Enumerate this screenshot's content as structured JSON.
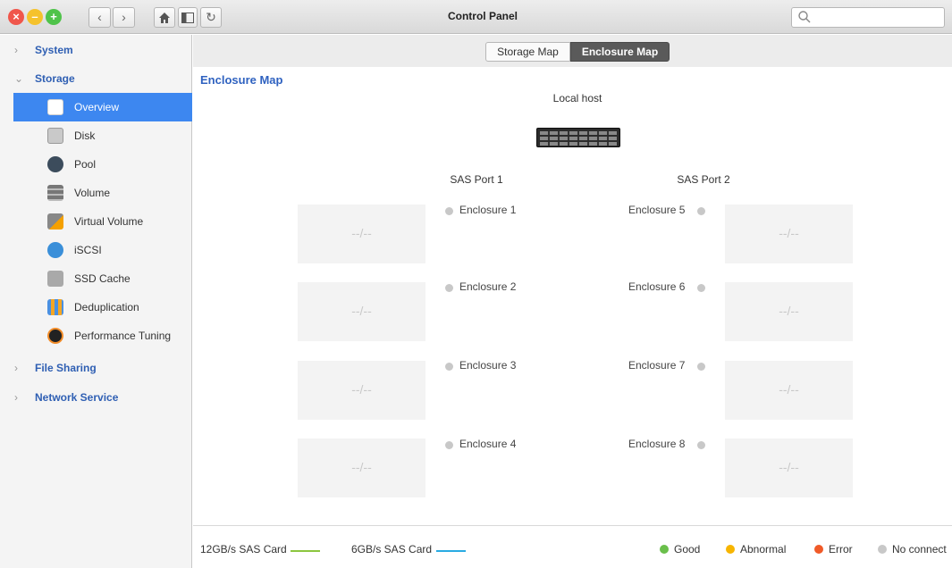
{
  "window": {
    "title": "Control Panel"
  },
  "toolbar": {
    "close_icon": "close-icon",
    "minimize_icon": "minimize-icon",
    "maximize_icon": "maximize-icon",
    "back_icon": "chevron-left-icon",
    "forward_icon": "chevron-right-icon",
    "home_icon": "home-icon",
    "sidebar_icon": "sidebar-toggle-icon",
    "refresh_icon": "refresh-icon",
    "search": {
      "placeholder": "",
      "icon": "search-icon"
    }
  },
  "sidebar": {
    "groups": [
      {
        "label": "System",
        "expanded": false
      },
      {
        "label": "Storage",
        "expanded": true
      },
      {
        "label": "File Sharing",
        "expanded": false
      },
      {
        "label": "Network Service",
        "expanded": false
      }
    ],
    "storage_items": [
      {
        "label": "Overview",
        "icon": "overview-icon",
        "selected": true
      },
      {
        "label": "Disk",
        "icon": "disk-icon"
      },
      {
        "label": "Pool",
        "icon": "pool-icon"
      },
      {
        "label": "Volume",
        "icon": "volume-icon"
      },
      {
        "label": "Virtual Volume",
        "icon": "virtual-volume-icon"
      },
      {
        "label": "iSCSI",
        "icon": "iscsi-icon"
      },
      {
        "label": "SSD Cache",
        "icon": "ssd-cache-icon"
      },
      {
        "label": "Deduplication",
        "icon": "deduplication-icon"
      },
      {
        "label": "Performance Tuning",
        "icon": "performance-tuning-icon"
      }
    ]
  },
  "main": {
    "tabs": [
      {
        "label": "Storage Map",
        "active": false
      },
      {
        "label": "Enclosure Map",
        "active": true
      }
    ],
    "section_title": "Enclosure Map",
    "local_host": "Local host",
    "ports": [
      "SAS Port 1",
      "SAS Port 2"
    ],
    "enclosures_left": [
      "Enclosure 1",
      "Enclosure 2",
      "Enclosure 3",
      "Enclosure 4"
    ],
    "enclosures_right": [
      "Enclosure 5",
      "Enclosure 6",
      "Enclosure 7",
      "Enclosure 8"
    ],
    "empty_placeholder": "--/--",
    "legend": {
      "cards": [
        {
          "label": "12GB/s SAS Card",
          "color": "#8cc63f"
        },
        {
          "label": "6GB/s SAS Card",
          "color": "#29abe2"
        }
      ],
      "statuses": [
        {
          "label": "Good",
          "color": "#6abf4b"
        },
        {
          "label": "Abnormal",
          "color": "#f7b500"
        },
        {
          "label": "Error",
          "color": "#f05a28"
        },
        {
          "label": "No connect",
          "color": "#c8c8c8"
        }
      ]
    }
  }
}
